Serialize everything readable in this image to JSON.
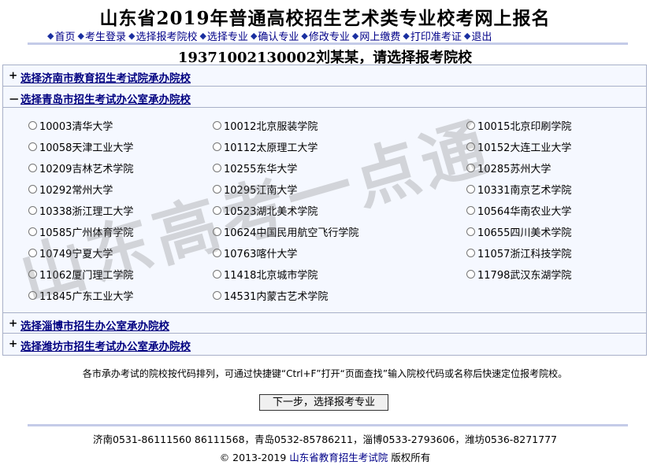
{
  "page_title": "山东省2019年普通高校招生艺术类专业校考网上报名",
  "nav": [
    {
      "label": "首页"
    },
    {
      "label": "考生登录"
    },
    {
      "label": "选择报考院校"
    },
    {
      "label": "选择专业"
    },
    {
      "label": "确认专业"
    },
    {
      "label": "修改专业"
    },
    {
      "label": "网上缴费"
    },
    {
      "label": "打印准考证"
    },
    {
      "label": "退出"
    }
  ],
  "subtitle": "19371002130002刘某某，请选择报考院校",
  "sections": [
    {
      "sign": "+",
      "label": "选择济南市教育招生考试院承办院校"
    },
    {
      "sign": "－",
      "label": "选择青岛市招生考试办公室承办院校"
    },
    {
      "sign": "+",
      "label": "选择淄博市招生办公室承办院校"
    },
    {
      "sign": "+",
      "label": "选择潍坊市招生考试办公室承办院校"
    }
  ],
  "schools": [
    "10003清华大学",
    "10012北京服装学院",
    "10015北京印刷学院",
    "10058天津工业大学",
    "10112太原理工大学",
    "10152大连工业大学",
    "10209吉林艺术学院",
    "10255东华大学",
    "10285苏州大学",
    "10292常州大学",
    "10295江南大学",
    "10331南京艺术学院",
    "10338浙江理工大学",
    "10523湖北美术学院",
    "10564华南农业大学",
    "10585广州体育学院",
    "10624中国民用航空飞行学院",
    "10655四川美术学院",
    "10749宁夏大学",
    "10763喀什大学",
    "11057浙江科技学院",
    "11062厦门理工学院",
    "11418北京城市学院",
    "11798武汉东湖学院",
    "11845广东工业大学",
    "14531内蒙古艺术学院"
  ],
  "note": "各市承办考试的院校按代码排列，可通过快捷键“Ctrl+F”打开“页面查找”输入院校代码或名称后快速定位报考院校。",
  "next_button": "下一步，选择报考专业",
  "contacts": "济南0531-86111560 86111568，青岛0532-85786211，淄博0533-2793606，潍坊0536-8271777",
  "copyright": {
    "prefix": "© 2013-2019",
    "org": "山东省教育招生考试院",
    "suffix": "版权所有"
  },
  "watermark": "山东高考一点通",
  "colors": {
    "link": "#000080",
    "panel_bg": "#f5f8ff",
    "rule": "#c4cbe8"
  }
}
